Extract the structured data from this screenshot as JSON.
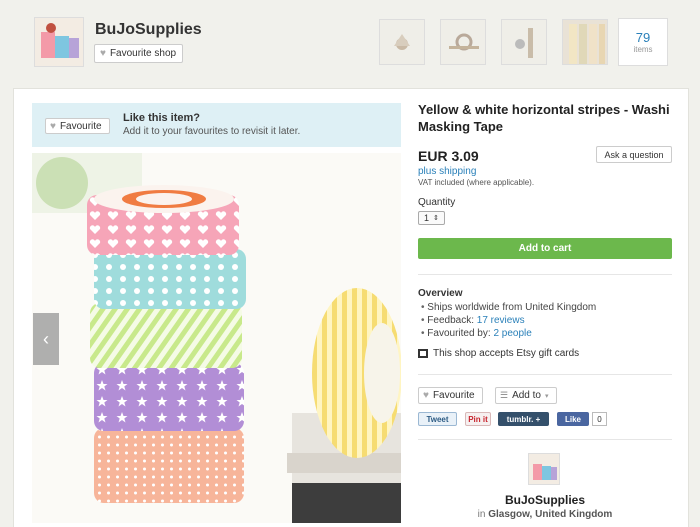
{
  "shop": {
    "name": "BuJoSupplies",
    "favourite_shop_label": "Favourite shop",
    "items_count": "79",
    "items_label": "items"
  },
  "banner": {
    "button_label": "Favourite",
    "title": "Like this item?",
    "text": "Add it to your favourites to revisit it later."
  },
  "listing": {
    "title": "Yellow & white horizontal stripes - Washi Masking Tape",
    "price": "EUR 3.09",
    "ask_label": "Ask a question",
    "shipping": "plus shipping",
    "vat": "VAT included (where applicable).",
    "quantity_label": "Quantity",
    "quantity_value": "1",
    "add_to_cart": "Add to cart"
  },
  "overview": {
    "title": "Overview",
    "ships": "Ships worldwide from United Kingdom",
    "feedback_prefix": "Feedback: ",
    "feedback_link": "17 reviews",
    "favourited_prefix": "Favourited by: ",
    "favourited_link": "2 people",
    "gift_cards": "This shop accepts Etsy gift cards"
  },
  "actions": {
    "favourite": "Favourite",
    "add_to": "Add to",
    "tweet": "Tweet",
    "pinit": "Pin it",
    "tumblr": "tumblr. +",
    "fb_like": "Like",
    "fb_count": "0"
  },
  "shop_footer": {
    "name": "BuJoSupplies",
    "location_prefix": "in ",
    "location": "Glasgow, United Kingdom"
  },
  "colors": {
    "accent_link": "#2a80b9",
    "add_to_cart": "#6cb84c",
    "banner_bg": "#def0f5"
  }
}
